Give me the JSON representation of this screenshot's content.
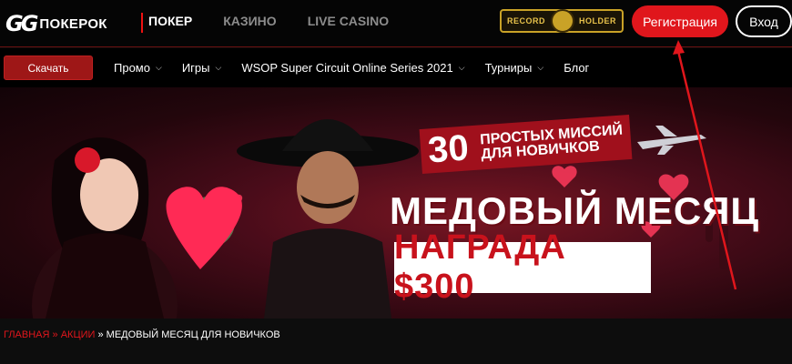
{
  "header": {
    "logo_mark": "GG",
    "logo_text": "ПОКЕРОК",
    "nav": [
      "ПОКЕР",
      "КАЗИНО",
      "LIVE CASINO"
    ],
    "record_left": "RECORD",
    "record_right": "HOLDER",
    "register_label": "Регистрация",
    "login_label": "Вход"
  },
  "subnav": {
    "download_label": "Скачать",
    "items": [
      "Промо",
      "Игры",
      "WSOP Super Circuit Online Series 2021",
      "Турниры",
      "Блог"
    ]
  },
  "banner": {
    "missions_number": "30",
    "missions_line1": "ПРОСТЫХ МИССИЙ",
    "missions_line2": "ДЛЯ НОВИЧКОВ",
    "headline": "МЕДОВЫЙ МЕСЯЦ",
    "reward": "НАГРАДА $300"
  },
  "breadcrumb": {
    "home": "ГЛАВНАЯ",
    "sep": "»",
    "promos": "АКЦИИ",
    "current": "МЕДОВЫЙ МЕСЯЦ ДЛЯ НОВИЧКОВ"
  },
  "colors": {
    "accent": "#e0161c",
    "gold": "#c9a227",
    "background": "#0d0d0d"
  }
}
